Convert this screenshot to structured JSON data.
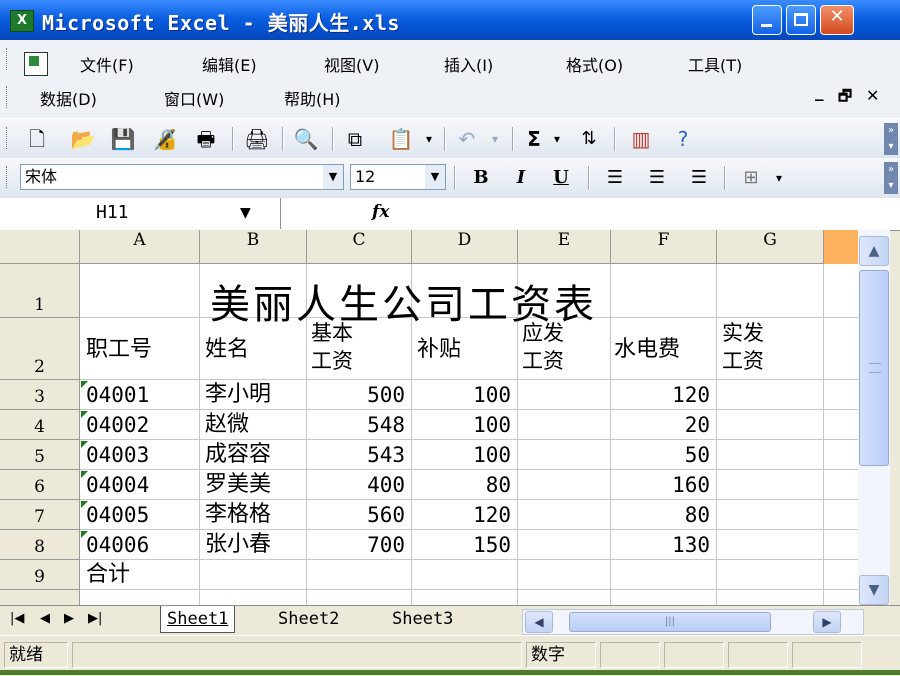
{
  "window": {
    "title": "Microsoft Excel - 美丽人生.xls",
    "app_icon": "excel-icon"
  },
  "menu": {
    "row1": [
      "文件(F)",
      "编辑(E)",
      "视图(V)",
      "插入(I)",
      "格式(O)",
      "工具(T)"
    ],
    "row2": [
      "数据(D)",
      "窗口(W)",
      "帮助(H)"
    ]
  },
  "toolbar": {
    "icons": [
      "new-icon",
      "open-icon",
      "save-icon",
      "permission-icon",
      "print-icon",
      "print-preview-icon",
      "research-icon",
      "copy-icon",
      "paste-icon",
      "undo-icon",
      "autosum-icon",
      "sort-ascending-icon",
      "chart-icon",
      "help-icon"
    ],
    "autosum_label": "Σ"
  },
  "format": {
    "font": "宋体",
    "size": "12",
    "bold": "B",
    "italic": "I",
    "underline": "U"
  },
  "formula_bar": {
    "name_box": "H11",
    "fx_label": "fx",
    "formula": ""
  },
  "sheet": {
    "columns": [
      "A",
      "B",
      "C",
      "D",
      "E",
      "F",
      "G"
    ],
    "rows": [
      "1",
      "2",
      "3",
      "4",
      "5",
      "6",
      "7",
      "8",
      "9"
    ],
    "title": "美丽人生公司工资表",
    "headers": [
      "职工号",
      "姓名",
      "基本工资",
      "补贴",
      "应发工资",
      "水电费",
      "实发工资"
    ],
    "header_lines": {
      "c1": "基本",
      "c2": "工资",
      "e1": "应发",
      "e2": "工资",
      "g1": "实发",
      "g2": "工资"
    },
    "data": [
      {
        "id": "04001",
        "name": "李小明",
        "base": "500",
        "sub": "100",
        "util": "120"
      },
      {
        "id": "04002",
        "name": "赵微",
        "base": "548",
        "sub": "100",
        "util": "20"
      },
      {
        "id": "04003",
        "name": "成容容",
        "base": "543",
        "sub": "100",
        "util": "50"
      },
      {
        "id": "04004",
        "name": "罗美美",
        "base": "400",
        "sub": "80",
        "util": "160"
      },
      {
        "id": "04005",
        "name": "李格格",
        "base": "560",
        "sub": "120",
        "util": "80"
      },
      {
        "id": "04006",
        "name": "张小春",
        "base": "700",
        "sub": "150",
        "util": "130"
      }
    ],
    "total_label": "合计"
  },
  "tabs": [
    "Sheet1",
    "Sheet2",
    "Sheet3"
  ],
  "status": {
    "left": "就绪",
    "mode": "数字"
  },
  "colors": {
    "title_bar": "#0553d2",
    "active_corner": "#ffb25e"
  }
}
